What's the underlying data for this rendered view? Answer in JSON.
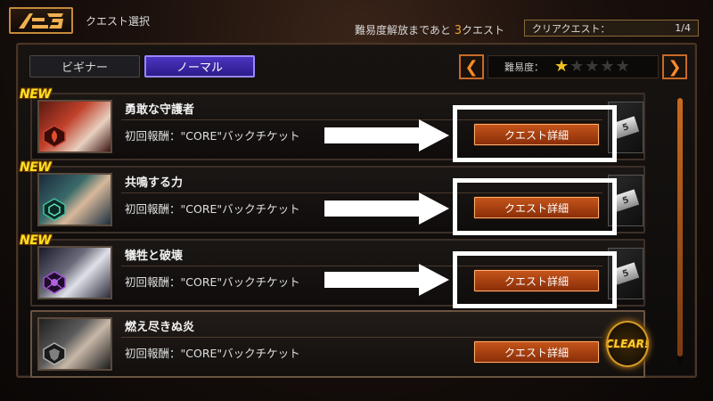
{
  "header": {
    "back_icon": "ac-logo-back-icon",
    "title": "クエスト選択",
    "unlock_prefix": "難易度解放まであと",
    "unlock_count": "3",
    "unlock_suffix": "クエスト",
    "clear_label": "クリアクエスト：",
    "clear_count": "1/4"
  },
  "tabs": [
    {
      "label": "ビギナー",
      "active": false
    },
    {
      "label": "ノーマル",
      "active": true
    }
  ],
  "difficulty": {
    "label": "難易度：",
    "rating": 1,
    "max": 5,
    "prev_icon": "chevron-left-icon",
    "next_icon": "chevron-right-icon"
  },
  "quests": [
    {
      "name": "勇敢な守護者",
      "reward": "初回報酬：\"CORE\"バックチケット",
      "button": "クエスト詳細",
      "new": "NEW",
      "cleared": false,
      "ticket": "5"
    },
    {
      "name": "共鳴する力",
      "reward": "初回報酬：\"CORE\"バックチケット",
      "button": "クエスト詳細",
      "new": "NEW",
      "cleared": false,
      "ticket": "5"
    },
    {
      "name": "犠牲と破壊",
      "reward": "初回報酬：\"CORE\"バックチケット",
      "button": "クエスト詳細",
      "new": "NEW",
      "cleared": false,
      "ticket": "5"
    },
    {
      "name": "燃え尽きぬ炎",
      "reward": "初回報酬：\"CORE\"バックチケット",
      "button": "クエスト詳細",
      "new": "",
      "cleared": true,
      "clear_label": "CLEAR!"
    }
  ],
  "colors": {
    "accent_orange": "#c4541a",
    "tab_active": "#4b34c0",
    "new_yellow": "#ffe020",
    "star_gold": "#f0c020",
    "star_empty": "#3a3a3a"
  }
}
